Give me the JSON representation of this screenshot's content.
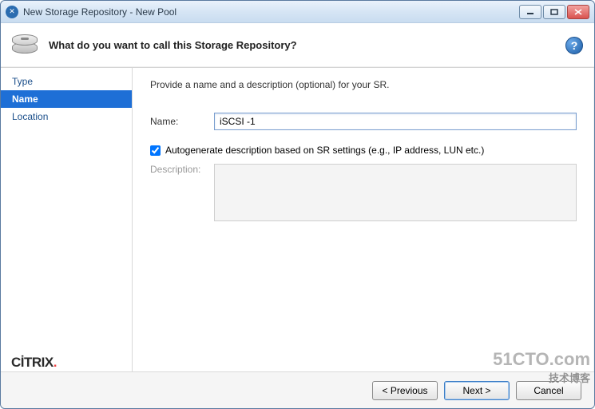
{
  "window": {
    "title": "New Storage Repository - New Pool"
  },
  "header": {
    "heading": "What do you want to call this Storage Repository?",
    "help_glyph": "?"
  },
  "sidebar": {
    "steps": [
      {
        "label": "Type",
        "active": false
      },
      {
        "label": "Name",
        "active": true
      },
      {
        "label": "Location",
        "active": false
      }
    ]
  },
  "form": {
    "intro": "Provide a name and a description (optional) for your SR.",
    "name_label": "Name:",
    "name_value": "iSCSI -1",
    "autogen_label": "Autogenerate description based on SR settings (e.g., IP address, LUN etc.)",
    "autogen_checked": true,
    "description_label": "Description:",
    "description_value": ""
  },
  "brand": {
    "text_main": "CİTRIX",
    "dot": "."
  },
  "footer": {
    "previous": "< Previous",
    "next": "Next >",
    "cancel": "Cancel"
  },
  "watermark": {
    "line1": "51CTO.com",
    "line2": "技术博客"
  }
}
